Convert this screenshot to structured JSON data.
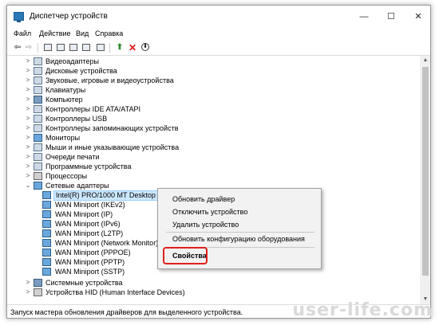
{
  "window": {
    "title": "Диспетчер устройств"
  },
  "window_controls": {
    "minimize": "—",
    "maximize": "☐",
    "close": "✕"
  },
  "menu": {
    "items": [
      "Файл",
      "Действие",
      "Вид",
      "Справка"
    ]
  },
  "tree": {
    "categories": [
      "Видеоадаптеры",
      "Дисковые устройства",
      "Звуковые, игровые и видеоустройства",
      "Клавиатуры",
      "Компьютер",
      "Контроллеры IDE ATA/ATAPI",
      "Контроллеры USB",
      "Контроллеры запоминающих устройств",
      "Мониторы",
      "Мыши и иные указывающие устройства",
      "Очереди печати",
      "Программные устройства",
      "Процессоры",
      "Сетевые адаптеры"
    ],
    "network_adapters": [
      "Intel(R) PRO/1000 MT Desktop Ada",
      "WAN Miniport (IKEv2)",
      "WAN Miniport (IP)",
      "WAN Miniport (IPv6)",
      "WAN Miniport (L2TP)",
      "WAN Miniport (Network Monitor)",
      "WAN Miniport (PPPOE)",
      "WAN Miniport (PPTP)",
      "WAN Miniport (SSTP)"
    ],
    "after": [
      "Системные устройства",
      "Устройства HID (Human Interface Devices)"
    ]
  },
  "context_menu": {
    "update_driver": "Обновить драйвер",
    "disable_device": "Отключить устройство",
    "uninstall_device": "Удалить устройство",
    "scan_hardware": "Обновить конфигурацию оборудования",
    "properties": "Свойства"
  },
  "status": {
    "text": "Запуск мастера обновления драйверов для выделенного устройства."
  },
  "watermark": "user-life.com",
  "colors": {
    "selection": "#cce8ff",
    "highlight_border": "#e0201c",
    "accent": "#2a7ab8"
  }
}
